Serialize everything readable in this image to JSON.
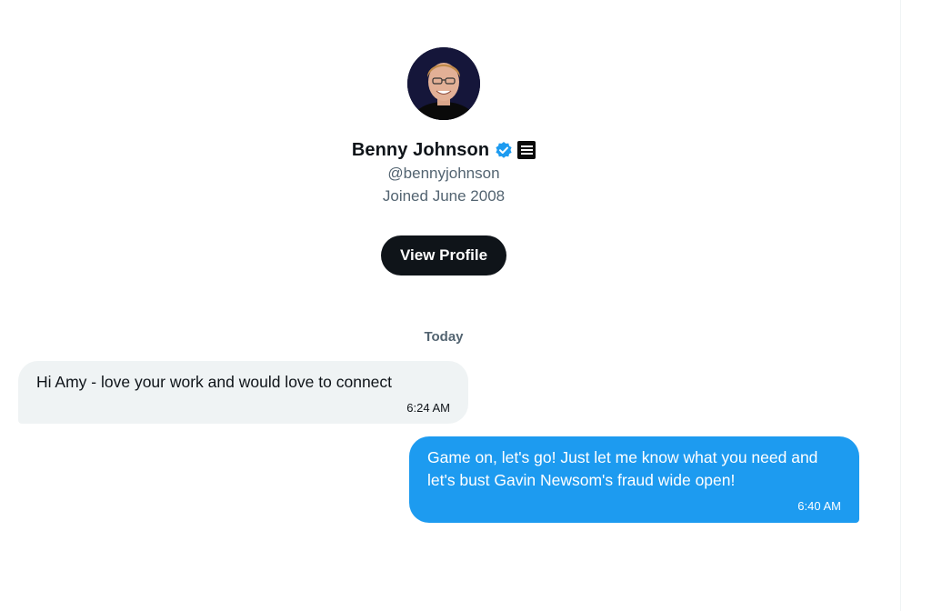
{
  "profile": {
    "display_name": "Benny Johnson",
    "handle": "@bennyjohnson",
    "joined": "Joined June 2008",
    "verified_icon": "verified-badge-icon",
    "affiliate_icon": "affiliate-badge-icon",
    "view_profile_label": "View Profile"
  },
  "conversation": {
    "date_label": "Today",
    "messages": [
      {
        "direction": "incoming",
        "text": "Hi Amy - love your work and would love to connect",
        "time": "6:24 AM"
      },
      {
        "direction": "outgoing",
        "text": "Game on, let's go! Just let me know what you need and let's bust Gavin Newsom's fraud wide open!",
        "time": "6:40 AM"
      }
    ]
  },
  "colors": {
    "accent": "#1d9bf0",
    "button_bg": "#0f1419",
    "incoming_bubble": "#eff3f4",
    "muted_text": "#536471"
  }
}
